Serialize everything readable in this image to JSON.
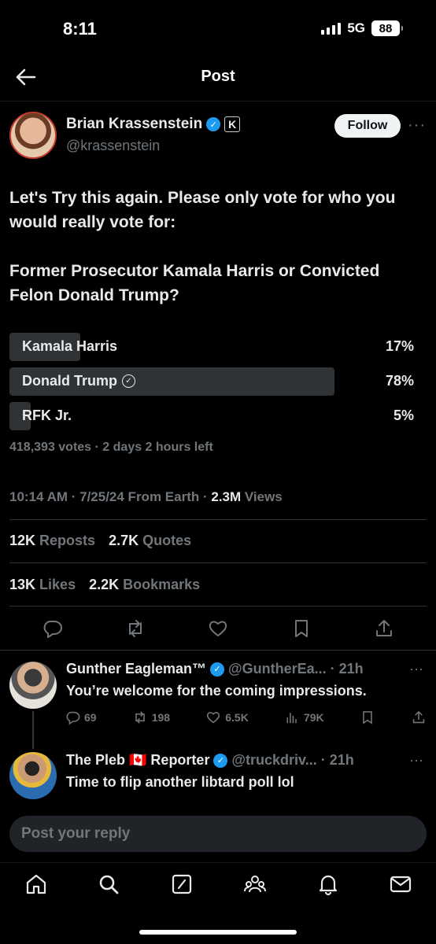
{
  "status_bar": {
    "time": "8:11",
    "network": "5G",
    "battery": "88"
  },
  "header": {
    "title": "Post"
  },
  "post": {
    "author": {
      "name": "Brian Krassenstein",
      "handle": "@krassenstein"
    },
    "follow_label": "Follow",
    "text": [
      "Let's Try this again.  Please only vote for who you would really vote for:",
      "Former Prosecutor Kamala Harris or Convicted Felon Donald Trump?"
    ],
    "poll": {
      "options": [
        {
          "label": "Kamala Harris",
          "percent": "17%",
          "fraction": 0.17
        },
        {
          "label": "Donald Trump",
          "percent": "78%",
          "fraction": 0.78,
          "selected": true
        },
        {
          "label": "RFK Jr.",
          "percent": "5%",
          "fraction": 0.05
        }
      ],
      "meta": "418,393 votes · 2 days 2 hours left"
    },
    "timestamp": "10:14 AM · 7/25/24 From Earth · ",
    "views": "2.3M",
    "views_label": " Views",
    "stats": {
      "reposts": "12K",
      "reposts_label": "Reposts",
      "quotes": "2.7K",
      "quotes_label": "Quotes",
      "likes": "13K",
      "likes_label": "Likes",
      "bookmarks": "2.2K",
      "bookmarks_label": "Bookmarks"
    }
  },
  "replies": [
    {
      "name": "Gunther Eagleman™",
      "handle": "@GuntherEa...",
      "time": "· 21h",
      "text": "You’re welcome for the coming impressions.",
      "replies": "69",
      "reposts": "198",
      "likes": "6.5K",
      "views": "79K"
    },
    {
      "name": "The Pleb 🇨🇦 Reporter",
      "handle": "@truckdriv...",
      "time": "· 21h",
      "text": "Time to flip another libtard poll lol"
    }
  ],
  "composer": {
    "placeholder": "Post your reply"
  },
  "colors": {
    "accent": "#1d9bf0",
    "bar": "#2f3336",
    "muted": "#71767b"
  }
}
